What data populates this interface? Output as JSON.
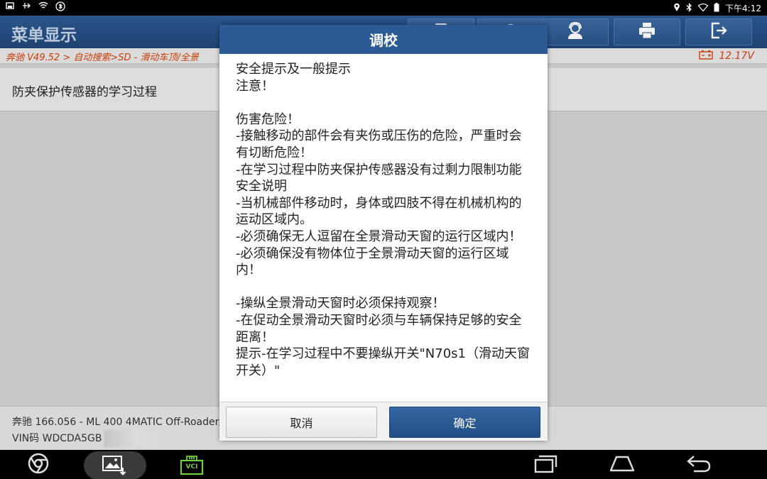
{
  "status_bar": {
    "time": "下午4:12"
  },
  "header": {
    "title": "菜单显示",
    "icons": [
      "help-icon",
      "support-icon",
      "print-icon",
      "exit-icon"
    ]
  },
  "breadcrumb": {
    "path": "奔驰 V49.52 > 自动搜索>SD - 滑动车顶/全景",
    "voltage": "12.17V"
  },
  "page": {
    "title": "防夹保护传感器的学习过程"
  },
  "vehicle": {
    "model": "奔驰 166.056 - ML 400 4MATIC Off-Roader/",
    "vin": "VIN码 WDCDA5GB"
  },
  "dialog": {
    "title": "调校",
    "message": "安全提示及一般提示\n注意！\n\n伤害危险！\n-接触移动的部件会有夹伤或压伤的危险，严重时会有切断危险！\n-在学习过程中防夹保护传感器没有过剩力限制功能\n安全说明\n-当机械部件移动时，身体或四肢不得在机械机构的运动区域内。\n-必须确保无人逗留在全景滑动天窗的运行区域内！\n-必须确保没有物体位于全景滑动天窗的运行区域内！\n\n-操纵全景滑动天窗时必须保持观察！\n-在促动全景滑动天窗时必须与车辆保持足够的安全距离！\n提示-在学习过程中不要操纵开关\"N70s1（滑动天窗开关）\"",
    "cancel_label": "取消",
    "confirm_label": "确定"
  },
  "nav_bar": {
    "icons": [
      "browser-icon",
      "screenshot-gallery-icon",
      "vci-icon",
      "recent-apps-icon",
      "home-icon",
      "back-icon"
    ],
    "vci_label": "VCI"
  },
  "colors": {
    "header_blue": "#1f4679",
    "dialog_header_blue": "#2b5a94",
    "confirm_blue": "#214e86",
    "breadcrumb_orange": "#d4420a",
    "vci_green": "#6fce3c"
  }
}
